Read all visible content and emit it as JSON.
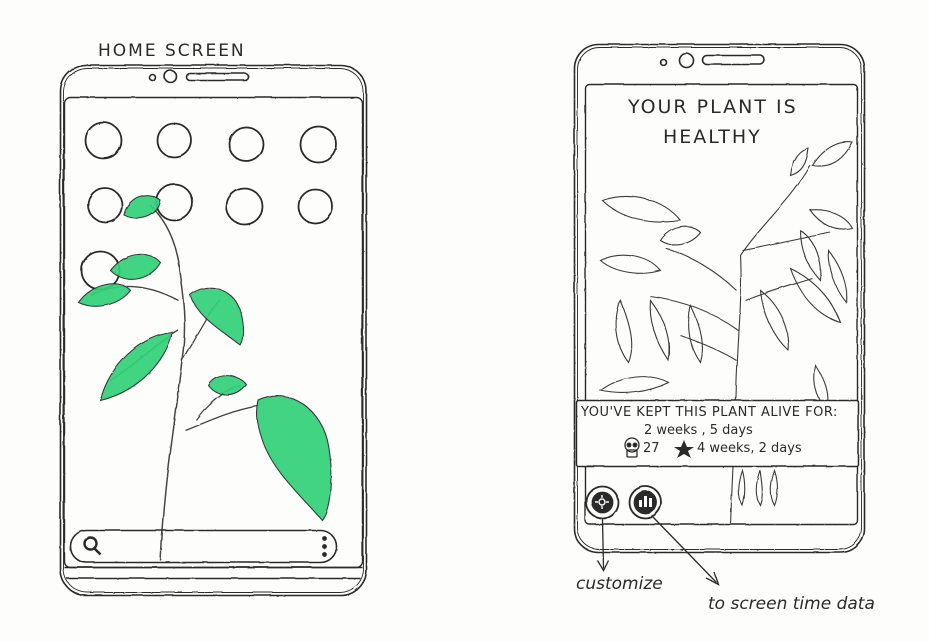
{
  "home_screen": {
    "title": "HOME SCREEN",
    "app_icon_count": 9,
    "search_bar": {
      "icon": "search-icon",
      "menu_icon": "more-vertical-icon"
    }
  },
  "plant_screen": {
    "status_line1": "YOUR PLANT IS",
    "status_line2": "HEALTHY",
    "alive_label": "YOU'VE KEPT THIS PLANT ALIVE FOR:",
    "alive_duration": "2 weeks , 5 days",
    "skull_count": "27",
    "star_duration": "4 weeks, 2 days",
    "buttons": [
      {
        "icon": "customize-gear-icon"
      },
      {
        "icon": "bar-chart-icon"
      }
    ]
  },
  "annotations": {
    "customize": "customize",
    "screen_time": "to screen time data"
  },
  "colors": {
    "leaf": "#2fd17a",
    "ink": "#2a2a2a"
  }
}
